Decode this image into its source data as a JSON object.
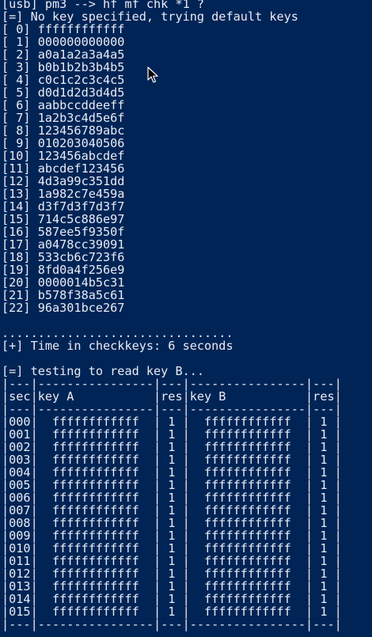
{
  "terminal": {
    "lines": [
      "[usb] pm3 --> hf mf chk *1 ?",
      "[=] No key specified, trying default keys",
      "[ 0] ffffffffffff",
      "[ 1] 000000000000",
      "[ 2] a0a1a2a3a4a5",
      "[ 3] b0b1b2b3b4b5",
      "[ 4] c0c1c2c3c4c5",
      "[ 5] d0d1d2d3d4d5",
      "[ 6] aabbccddeeff",
      "[ 7] 1a2b3c4d5e6f",
      "[ 8] 123456789abc",
      "[ 9] 010203040506",
      "[10] 123456abcdef",
      "[11] abcdef123456",
      "[12] 4d3a99c351dd",
      "[13] 1a982c7e459a",
      "[14] d3f7d3f7d3f7",
      "[15] 714c5c886e97",
      "[16] 587ee5f9350f",
      "[17] a0478cc39091",
      "[18] 533cb6c723f6",
      "[19] 8fd0a4f256e9",
      "[20] 0000014b5c31",
      "[21] b578f38a5c61",
      "[22] 96a301bce267",
      "",
      "................................",
      "[+] Time in checkkeys: 6 seconds",
      "",
      "[=] testing to read key B...",
      "|---|----------------|---|----------------|---|",
      "|sec|key A           |res|key B           |res|",
      "|---|----------------|---|----------------|---|",
      "|000|  ffffffffffff  | 1 |  ffffffffffff  | 1 |",
      "|001|  ffffffffffff  | 1 |  ffffffffffff  | 1 |",
      "|002|  ffffffffffff  | 1 |  ffffffffffff  | 1 |",
      "|003|  ffffffffffff  | 1 |  ffffffffffff  | 1 |",
      "|004|  ffffffffffff  | 1 |  ffffffffffff  | 1 |",
      "|005|  ffffffffffff  | 1 |  ffffffffffff  | 1 |",
      "|006|  ffffffffffff  | 1 |  ffffffffffff  | 1 |",
      "|007|  ffffffffffff  | 1 |  ffffffffffff  | 1 |",
      "|008|  ffffffffffff  | 1 |  ffffffffffff  | 1 |",
      "|009|  ffffffffffff  | 1 |  ffffffffffff  | 1 |",
      "|010|  ffffffffffff  | 1 |  ffffffffffff  | 1 |",
      "|011|  ffffffffffff  | 1 |  ffffffffffff  | 1 |",
      "|012|  ffffffffffff  | 1 |  ffffffffffff  | 1 |",
      "|013|  ffffffffffff  | 1 |  ffffffffffff  | 1 |",
      "|014|  ffffffffffff  | 1 |  ffffffffffff  | 1 |",
      "|015|  ffffffffffff  | 1 |  ffffffffffff  | 1 |",
      "|---|----------------|---|----------------|---|"
    ]
  },
  "colors": {
    "background": "#012456",
    "foreground": "#e8ecf4"
  },
  "cursor": {
    "icon": "mouse-pointer-icon"
  }
}
